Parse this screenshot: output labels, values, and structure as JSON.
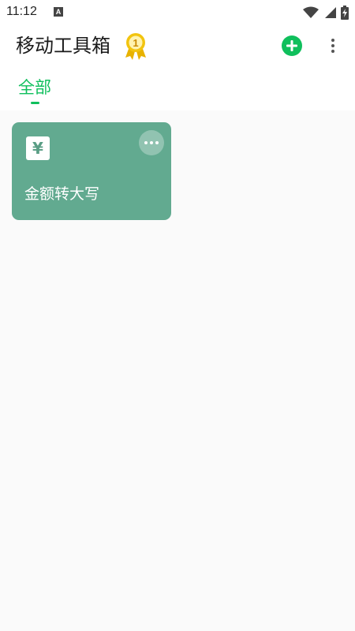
{
  "status_bar": {
    "time": "11:12",
    "notification_icon": "A",
    "icons": [
      "wifi-icon",
      "signal-icon",
      "battery-charging-icon"
    ]
  },
  "app_bar": {
    "title": "移动工具箱",
    "medal_number": "1",
    "actions": [
      "add-icon",
      "more-vert-icon"
    ]
  },
  "tabs": [
    {
      "label": "全部",
      "selected": true
    }
  ],
  "tools": [
    {
      "icon_text": "¥",
      "title": "金额转大写",
      "color": "#62aa90"
    }
  ],
  "colors": {
    "accent": "#0fbf5c",
    "card": "#62aa90",
    "background": "#fafafa"
  }
}
